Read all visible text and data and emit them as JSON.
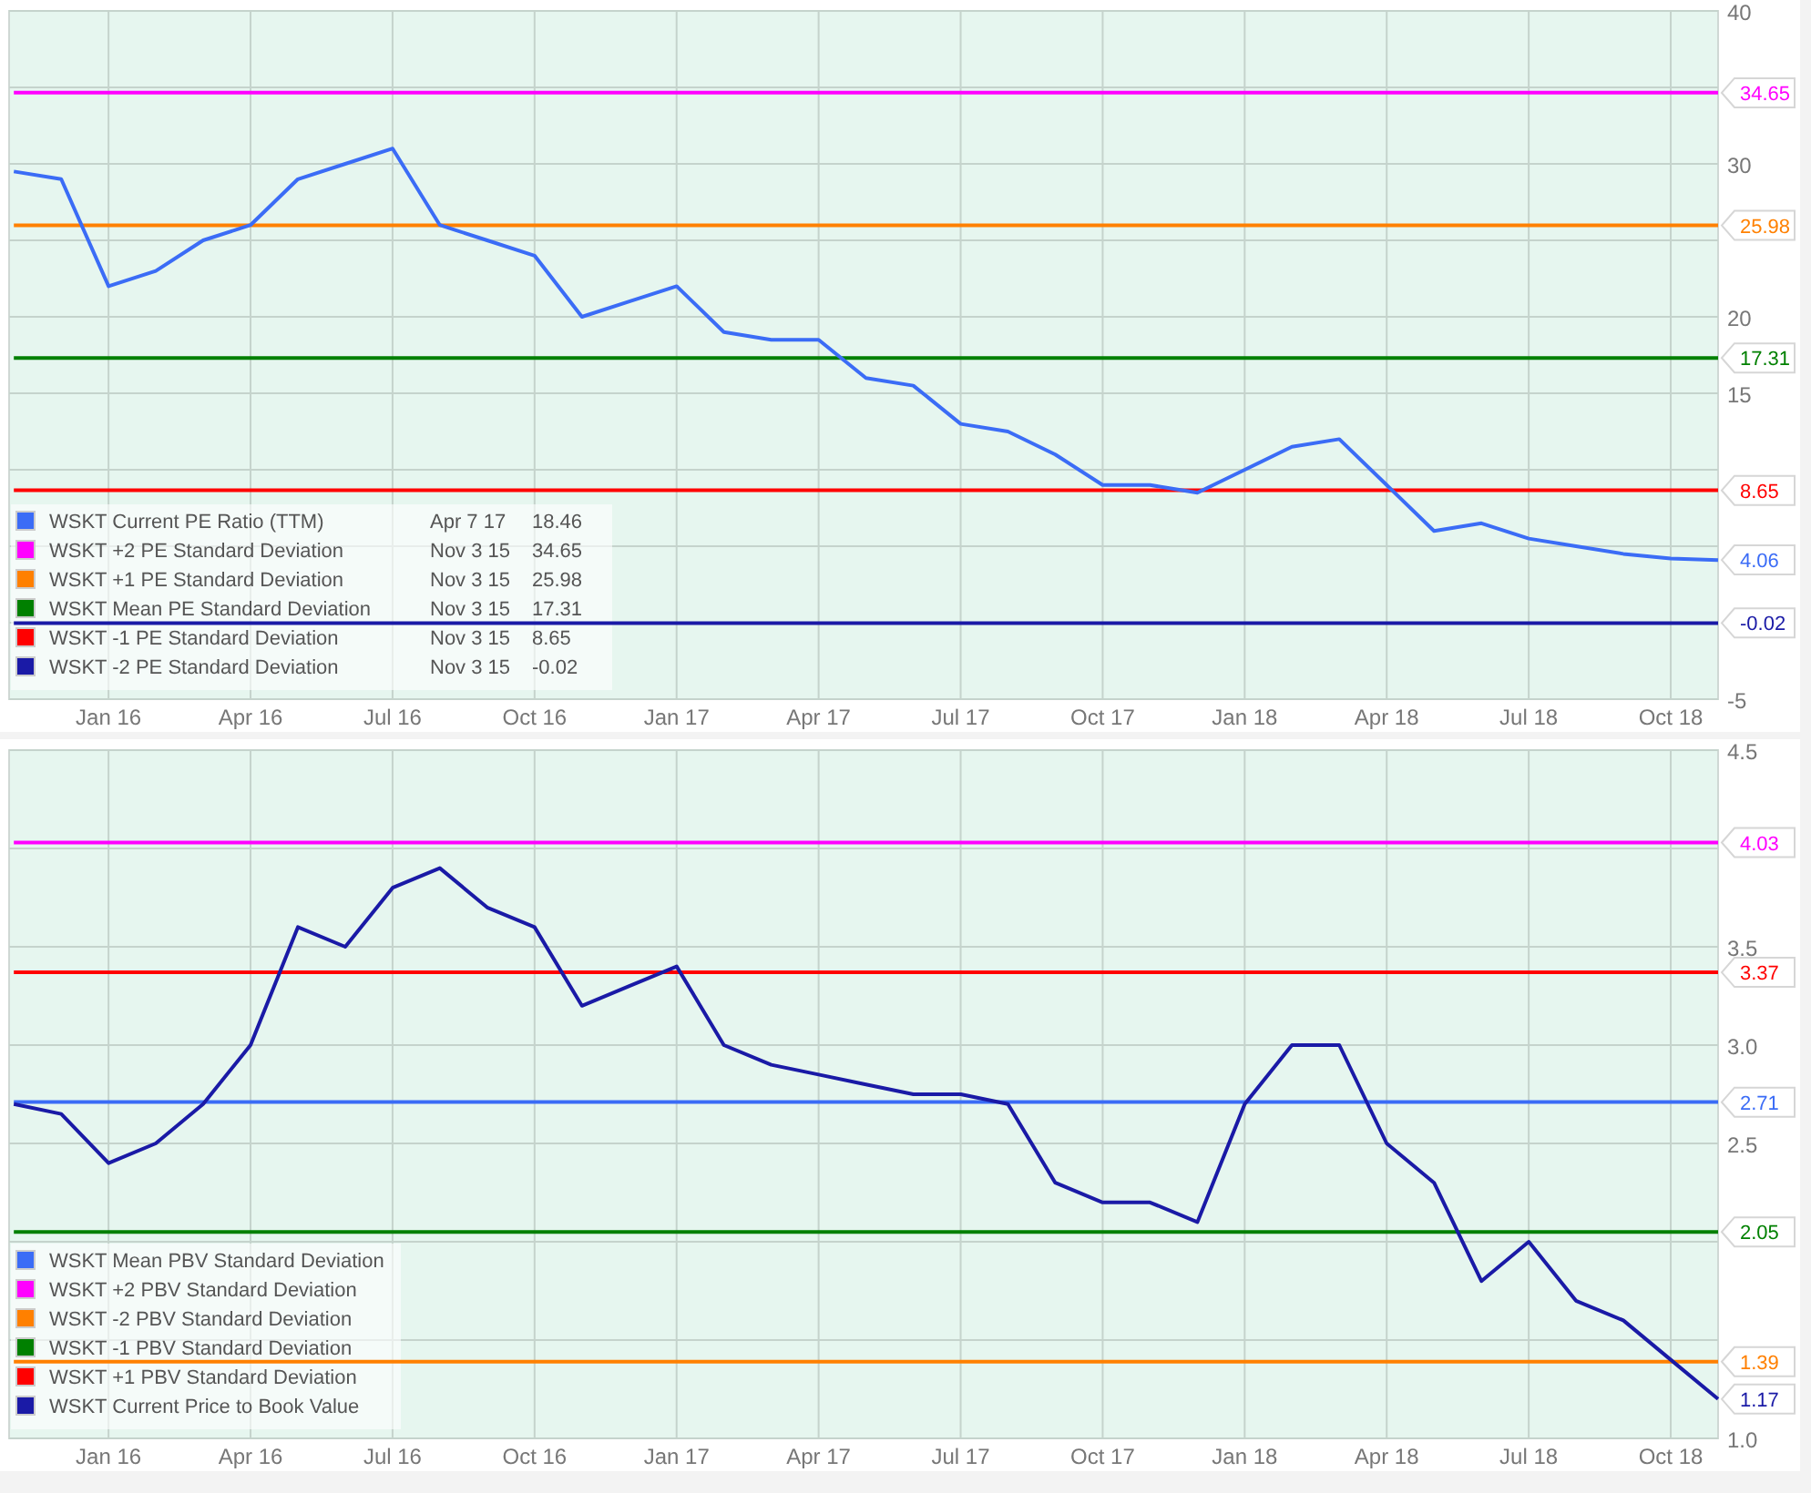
{
  "charts": [
    {
      "legend": [
        {
          "date": "Apr 7 17",
          "value": "18.46"
        },
        {
          "date": "Nov 3 15",
          "value": "34.65"
        },
        {
          "date": "Nov 3 15",
          "value": "25.98"
        },
        {
          "date": "Nov 3 15",
          "value": "17.31"
        },
        {
          "date": "Nov 3 15",
          "value": "8.65"
        },
        {
          "date": "Nov 3 15",
          "value": "-0.02"
        }
      ],
      "value_tags": [
        {
          "text": "34.65",
          "color": "#ff00ff"
        },
        {
          "text": "25.98",
          "color": "#ff8000"
        },
        {
          "text": "17.31",
          "color": "#008000"
        },
        {
          "text": "8.65",
          "color": "#ff0000"
        },
        {
          "text": "4.06",
          "color": "#3b6cf6"
        },
        {
          "text": "-0.02",
          "color": "#1a1aa6"
        }
      ],
      "chart_data": {
        "type": "line",
        "grid": true,
        "legend": "lower left",
        "ylim": [
          -5,
          40
        ],
        "categories": [
          null,
          null,
          "Jan 16",
          null,
          null,
          "Apr 16",
          null,
          null,
          "Jul 16",
          null,
          null,
          "Oct 16",
          null,
          null,
          "Jan 17",
          null,
          null,
          "Apr 17",
          null,
          null,
          "Jul 17",
          null,
          null,
          "Oct 17",
          null,
          null,
          "Jan 18",
          null,
          null,
          "Apr 18",
          null,
          null,
          "Jul 18",
          null,
          null,
          "Oct 18",
          null
        ],
        "yticks": [
          -5,
          15,
          20,
          30,
          40
        ],
        "series": [
          {
            "name": "WSKT Current PE Ratio (TTM)",
            "color": "#3b6cf6",
            "values": [
              29.5,
              29,
              22,
              23,
              25,
              26,
              29,
              30,
              31,
              26,
              25,
              24,
              20,
              21,
              22,
              19,
              18.5,
              18.5,
              16,
              15.5,
              13,
              12.5,
              11,
              9,
              9,
              8.5,
              10,
              11.5,
              12,
              9,
              6,
              6.5,
              5.5,
              5,
              4.5,
              4.2,
              4.1
            ]
          },
          {
            "name": "WSKT +2 PE Standard Deviation",
            "color": "#ff00ff",
            "values": [
              34.65,
              34.65,
              34.65,
              34.65,
              34.65,
              34.65,
              34.65,
              34.65,
              34.65,
              34.65,
              34.65,
              34.65,
              34.65,
              34.65,
              34.65,
              34.65,
              34.65,
              34.65,
              34.65,
              34.65,
              34.65,
              34.65,
              34.65,
              34.65,
              34.65,
              34.65,
              34.65,
              34.65,
              34.65,
              34.65,
              34.65,
              34.65,
              34.65,
              34.65,
              34.65,
              34.65,
              34.65
            ]
          },
          {
            "name": "WSKT +1 PE Standard Deviation",
            "color": "#ff8000",
            "values": [
              25.98,
              25.98,
              25.98,
              25.98,
              25.98,
              25.98,
              25.98,
              25.98,
              25.98,
              25.98,
              25.98,
              25.98,
              25.98,
              25.98,
              25.98,
              25.98,
              25.98,
              25.98,
              25.98,
              25.98,
              25.98,
              25.98,
              25.98,
              25.98,
              25.98,
              25.98,
              25.98,
              25.98,
              25.98,
              25.98,
              25.98,
              25.98,
              25.98,
              25.98,
              25.98,
              25.98,
              25.98
            ]
          },
          {
            "name": "WSKT Mean PE Standard Deviation",
            "color": "#008000",
            "values": [
              17.31,
              17.31,
              17.31,
              17.31,
              17.31,
              17.31,
              17.31,
              17.31,
              17.31,
              17.31,
              17.31,
              17.31,
              17.31,
              17.31,
              17.31,
              17.31,
              17.31,
              17.31,
              17.31,
              17.31,
              17.31,
              17.31,
              17.31,
              17.31,
              17.31,
              17.31,
              17.31,
              17.31,
              17.31,
              17.31,
              17.31,
              17.31,
              17.31,
              17.31,
              17.31,
              17.31,
              17.31
            ]
          },
          {
            "name": "WSKT -1 PE Standard Deviation",
            "color": "#ff0000",
            "values": [
              8.65,
              8.65,
              8.65,
              8.65,
              8.65,
              8.65,
              8.65,
              8.65,
              8.65,
              8.65,
              8.65,
              8.65,
              8.65,
              8.65,
              8.65,
              8.65,
              8.65,
              8.65,
              8.65,
              8.65,
              8.65,
              8.65,
              8.65,
              8.65,
              8.65,
              8.65,
              8.65,
              8.65,
              8.65,
              8.65,
              8.65,
              8.65,
              8.65,
              8.65,
              8.65,
              8.65,
              8.65
            ]
          },
          {
            "name": "WSKT -2 PE Standard Deviation",
            "color": "#1a1aa6",
            "values": [
              -0.02,
              -0.02,
              -0.02,
              -0.02,
              -0.02,
              -0.02,
              -0.02,
              -0.02,
              -0.02,
              -0.02,
              -0.02,
              -0.02,
              -0.02,
              -0.02,
              -0.02,
              -0.02,
              -0.02,
              -0.02,
              -0.02,
              -0.02,
              -0.02,
              -0.02,
              -0.02,
              -0.02,
              -0.02,
              -0.02,
              -0.02,
              -0.02,
              -0.02,
              -0.02,
              -0.02,
              -0.02,
              -0.02,
              -0.02,
              -0.02,
              -0.02,
              -0.02
            ]
          }
        ]
      }
    },
    {
      "value_tags": [
        {
          "text": "4.03",
          "color": "#ff00ff"
        },
        {
          "text": "3.37",
          "color": "#ff0000"
        },
        {
          "text": "2.71",
          "color": "#3b6cf6"
        },
        {
          "text": "2.05",
          "color": "#008000"
        },
        {
          "text": "1.39",
          "color": "#ff8000"
        },
        {
          "text": "1.17",
          "color": "#1a1aa6"
        }
      ],
      "chart_data": {
        "type": "line",
        "grid": true,
        "legend": "lower left",
        "ylim": [
          1,
          4.5
        ],
        "categories": [
          null,
          null,
          "Jan 16",
          null,
          null,
          "Apr 16",
          null,
          null,
          "Jul 16",
          null,
          null,
          "Oct 16",
          null,
          null,
          "Jan 17",
          null,
          null,
          "Apr 17",
          null,
          null,
          "Jul 17",
          null,
          null,
          "Oct 17",
          null,
          null,
          "Jan 18",
          null,
          null,
          "Apr 18",
          null,
          null,
          "Jul 18",
          null,
          null,
          "Oct 18",
          null
        ],
        "yticks": [
          {
            "value": 1,
            "label": "1.0"
          },
          {
            "value": 2.5,
            "label": "2.5"
          },
          {
            "value": 3,
            "label": "3.0"
          },
          {
            "value": 3.5,
            "label": "3.5"
          },
          {
            "value": 4.5,
            "label": "4.5"
          }
        ],
        "series": [
          {
            "name": "WSKT Mean PBV Standard Deviation",
            "color": "#3b6cf6",
            "values": [
              2.71,
              2.71,
              2.71,
              2.71,
              2.71,
              2.71,
              2.71,
              2.71,
              2.71,
              2.71,
              2.71,
              2.71,
              2.71,
              2.71,
              2.71,
              2.71,
              2.71,
              2.71,
              2.71,
              2.71,
              2.71,
              2.71,
              2.71,
              2.71,
              2.71,
              2.71,
              2.71,
              2.71,
              2.71,
              2.71,
              2.71,
              2.71,
              2.71,
              2.71,
              2.71,
              2.71,
              2.71
            ]
          },
          {
            "name": "WSKT +2 PBV Standard Deviation",
            "color": "#ff00ff",
            "values": [
              4.03,
              4.03,
              4.03,
              4.03,
              4.03,
              4.03,
              4.03,
              4.03,
              4.03,
              4.03,
              4.03,
              4.03,
              4.03,
              4.03,
              4.03,
              4.03,
              4.03,
              4.03,
              4.03,
              4.03,
              4.03,
              4.03,
              4.03,
              4.03,
              4.03,
              4.03,
              4.03,
              4.03,
              4.03,
              4.03,
              4.03,
              4.03,
              4.03,
              4.03,
              4.03,
              4.03,
              4.03
            ]
          },
          {
            "name": "WSKT -2 PBV Standard Deviation",
            "color": "#ff8000",
            "values": [
              1.39,
              1.39,
              1.39,
              1.39,
              1.39,
              1.39,
              1.39,
              1.39,
              1.39,
              1.39,
              1.39,
              1.39,
              1.39,
              1.39,
              1.39,
              1.39,
              1.39,
              1.39,
              1.39,
              1.39,
              1.39,
              1.39,
              1.39,
              1.39,
              1.39,
              1.39,
              1.39,
              1.39,
              1.39,
              1.39,
              1.39,
              1.39,
              1.39,
              1.39,
              1.39,
              1.39,
              1.39
            ]
          },
          {
            "name": "WSKT -1 PBV Standard Deviation",
            "color": "#008000",
            "values": [
              2.05,
              2.05,
              2.05,
              2.05,
              2.05,
              2.05,
              2.05,
              2.05,
              2.05,
              2.05,
              2.05,
              2.05,
              2.05,
              2.05,
              2.05,
              2.05,
              2.05,
              2.05,
              2.05,
              2.05,
              2.05,
              2.05,
              2.05,
              2.05,
              2.05,
              2.05,
              2.05,
              2.05,
              2.05,
              2.05,
              2.05,
              2.05,
              2.05,
              2.05,
              2.05,
              2.05,
              2.05
            ]
          },
          {
            "name": "WSKT +1 PBV Standard Deviation",
            "color": "#ff0000",
            "values": [
              3.37,
              3.37,
              3.37,
              3.37,
              3.37,
              3.37,
              3.37,
              3.37,
              3.37,
              3.37,
              3.37,
              3.37,
              3.37,
              3.37,
              3.37,
              3.37,
              3.37,
              3.37,
              3.37,
              3.37,
              3.37,
              3.37,
              3.37,
              3.37,
              3.37,
              3.37,
              3.37,
              3.37,
              3.37,
              3.37,
              3.37,
              3.37,
              3.37,
              3.37,
              3.37,
              3.37,
              3.37
            ]
          },
          {
            "name": "WSKT Current Price to Book Value",
            "color": "#1a1aa6",
            "values": [
              2.7,
              2.65,
              2.4,
              2.5,
              2.7,
              3.0,
              3.6,
              3.5,
              3.8,
              3.9,
              3.7,
              3.6,
              3.2,
              3.3,
              3.4,
              3.0,
              2.9,
              2.85,
              2.8,
              2.75,
              2.75,
              2.7,
              2.3,
              2.2,
              2.2,
              2.1,
              2.7,
              3.0,
              3.0,
              2.5,
              2.3,
              1.8,
              2.0,
              1.7,
              1.6,
              1.4,
              1.2
            ]
          }
        ]
      }
    }
  ]
}
